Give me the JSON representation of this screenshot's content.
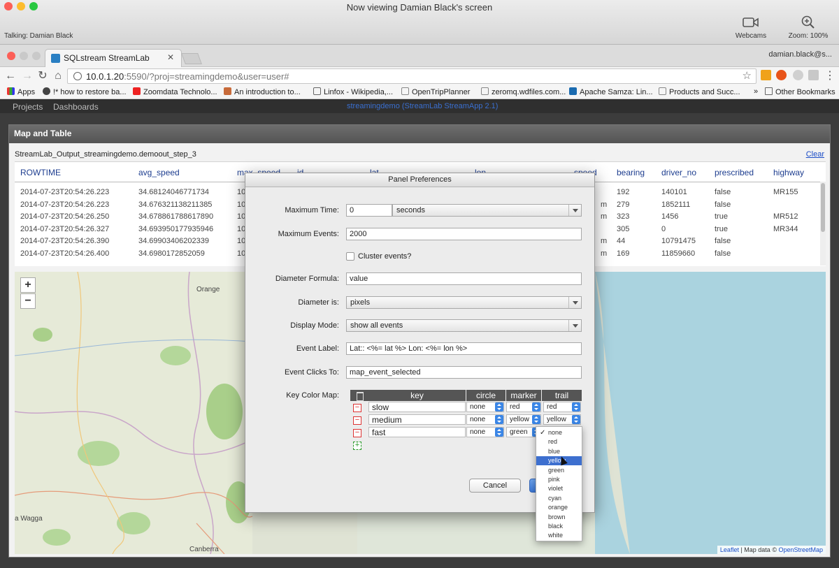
{
  "share": {
    "title": "Now viewing Damian Black's screen",
    "talking": "Talking: Damian Black",
    "webcams_label": "Webcams",
    "zoom_label": "Zoom: 100%"
  },
  "browser": {
    "tab_title": "SQLstream StreamLab",
    "profile": "damian.black@s...",
    "url_host": "10.0.1.20",
    "url_rest": ":5590/?proj=streamingdemo&user=user#",
    "bookmarks": [
      "Apps",
      "!* how to restore ba...",
      "Zoomdata Technolo...",
      "An introduction to...",
      "Linfox - Wikipedia,...",
      "OpenTripPlanner",
      "zeromq.wdfiles.com...",
      "Apache Samza: Lin...",
      "Products and Succ..."
    ],
    "bookmarks_more": "»",
    "other_bookmarks": "Other Bookmarks"
  },
  "app": {
    "nav_projects": "Projects",
    "nav_dashboards": "Dashboards",
    "center_title": "streamingdemo (StreamLab StreamApp 2.1)"
  },
  "panel": {
    "title": "Map and Table",
    "subtitle": "StreamLab_Output_streamingdemo.demoout_step_3",
    "clear": "Clear",
    "columns": [
      "ROWTIME",
      "avg_speed",
      "max_speed",
      "id",
      "lat",
      "lon",
      "speed",
      "bearing",
      "driver_no",
      "prescribed",
      "highway"
    ],
    "rows": [
      {
        "rowtime": "2014-07-23T20:54:26.223",
        "avg": "34.68124046771734",
        "max": "10",
        "bearing": "192",
        "driver": "140101",
        "pres": "false",
        "hw": "MR155",
        "spd": ""
      },
      {
        "rowtime": "2014-07-23T20:54:26.223",
        "avg": "34.676321138211385",
        "max": "10",
        "bearing": "279",
        "driver": "1852111",
        "pres": "false",
        "hw": "",
        "spd": "m"
      },
      {
        "rowtime": "2014-07-23T20:54:26.250",
        "avg": "34.678861788617890",
        "max": "10",
        "bearing": "323",
        "driver": "1456",
        "pres": "true",
        "hw": "MR512",
        "spd": "m"
      },
      {
        "rowtime": "2014-07-23T20:54:26.327",
        "avg": "34.693950177935946",
        "max": "10",
        "bearing": "305",
        "driver": "0",
        "pres": "true",
        "hw": "MR344",
        "spd": ""
      },
      {
        "rowtime": "2014-07-23T20:54:26.390",
        "avg": "34.69903406202339",
        "max": "10",
        "bearing": "44",
        "driver": "10791475",
        "pres": "false",
        "hw": "",
        "spd": "m"
      },
      {
        "rowtime": "2014-07-23T20:54:26.400",
        "avg": "34.6980172852059",
        "max": "10",
        "bearing": "169",
        "driver": "11859660",
        "pres": "false",
        "hw": "",
        "spd": "m"
      }
    ],
    "map": {
      "zoom_in": "+",
      "zoom_out": "−",
      "label_orange": "Orange",
      "label_wagga": "a Wagga",
      "label_canberra": "Canberra",
      "attrib_leaflet": "Leaflet",
      "attrib_mid": " | Map data © ",
      "attrib_osm": "OpenStreetMap"
    }
  },
  "dialog": {
    "title": "Panel Preferences",
    "max_time_label": "Maximum Time:",
    "max_time_value": "0",
    "max_time_unit": "seconds",
    "max_events_label": "Maximum Events:",
    "max_events_value": "2000",
    "cluster_label": "Cluster events?",
    "diameter_formula_label": "Diameter Formula:",
    "diameter_formula_value": "value",
    "diameter_is_label": "Diameter is:",
    "diameter_is_value": "pixels",
    "display_mode_label": "Display Mode:",
    "display_mode_value": "show all events",
    "event_label_label": "Event Label:",
    "event_label_value": "Lat:: <%= lat %> Lon: <%= lon %>",
    "event_clicks_label": "Event Clicks To:",
    "event_clicks_value": "map_event_selected",
    "key_color_map_label": "Key Color Map:",
    "kc_headers": [
      "key",
      "circle",
      "marker",
      "trail"
    ],
    "kc_rows": [
      {
        "key": "slow",
        "circle": "none",
        "marker": "red",
        "trail": "red"
      },
      {
        "key": "medium",
        "circle": "none",
        "marker": "yellow",
        "trail": "yellow"
      },
      {
        "key": "fast",
        "circle": "none",
        "marker": "green",
        "trail": ""
      }
    ],
    "remove_symbol": "−",
    "add_symbol": "+",
    "cancel": "Cancel",
    "ok": ""
  },
  "popup": {
    "check": "✓",
    "options": [
      "none",
      "red",
      "blue",
      "yellow",
      "green",
      "pink",
      "violet",
      "cyan",
      "orange",
      "brown",
      "black",
      "white"
    ],
    "highlighted": "yellow"
  },
  "colors": {
    "link": "#1a4cc7",
    "header_text": "#1d3d8f",
    "highlight": "#3d6fcf",
    "stepper": "#3b86e6"
  }
}
